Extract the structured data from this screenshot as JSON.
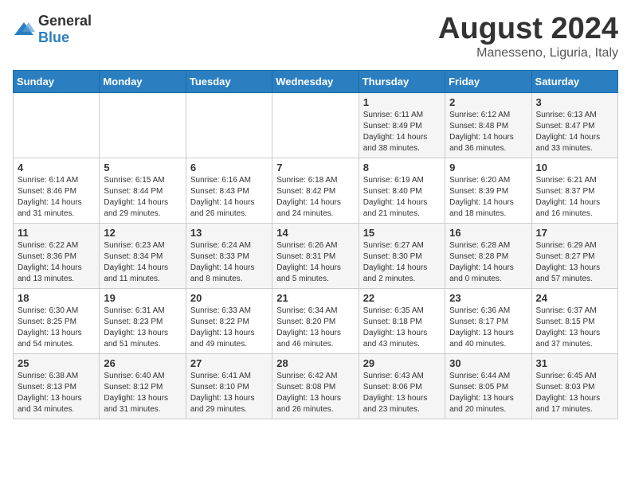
{
  "logo": {
    "text_general": "General",
    "text_blue": "Blue"
  },
  "title": "August 2024",
  "location": "Manesseno, Liguria, Italy",
  "days_of_week": [
    "Sunday",
    "Monday",
    "Tuesday",
    "Wednesday",
    "Thursday",
    "Friday",
    "Saturday"
  ],
  "weeks": [
    [
      {
        "day": "",
        "info": ""
      },
      {
        "day": "",
        "info": ""
      },
      {
        "day": "",
        "info": ""
      },
      {
        "day": "",
        "info": ""
      },
      {
        "day": "1",
        "info": "Sunrise: 6:11 AM\nSunset: 8:49 PM\nDaylight: 14 hours\nand 38 minutes."
      },
      {
        "day": "2",
        "info": "Sunrise: 6:12 AM\nSunset: 8:48 PM\nDaylight: 14 hours\nand 36 minutes."
      },
      {
        "day": "3",
        "info": "Sunrise: 6:13 AM\nSunset: 8:47 PM\nDaylight: 14 hours\nand 33 minutes."
      }
    ],
    [
      {
        "day": "4",
        "info": "Sunrise: 6:14 AM\nSunset: 8:46 PM\nDaylight: 14 hours\nand 31 minutes."
      },
      {
        "day": "5",
        "info": "Sunrise: 6:15 AM\nSunset: 8:44 PM\nDaylight: 14 hours\nand 29 minutes."
      },
      {
        "day": "6",
        "info": "Sunrise: 6:16 AM\nSunset: 8:43 PM\nDaylight: 14 hours\nand 26 minutes."
      },
      {
        "day": "7",
        "info": "Sunrise: 6:18 AM\nSunset: 8:42 PM\nDaylight: 14 hours\nand 24 minutes."
      },
      {
        "day": "8",
        "info": "Sunrise: 6:19 AM\nSunset: 8:40 PM\nDaylight: 14 hours\nand 21 minutes."
      },
      {
        "day": "9",
        "info": "Sunrise: 6:20 AM\nSunset: 8:39 PM\nDaylight: 14 hours\nand 18 minutes."
      },
      {
        "day": "10",
        "info": "Sunrise: 6:21 AM\nSunset: 8:37 PM\nDaylight: 14 hours\nand 16 minutes."
      }
    ],
    [
      {
        "day": "11",
        "info": "Sunrise: 6:22 AM\nSunset: 8:36 PM\nDaylight: 14 hours\nand 13 minutes."
      },
      {
        "day": "12",
        "info": "Sunrise: 6:23 AM\nSunset: 8:34 PM\nDaylight: 14 hours\nand 11 minutes."
      },
      {
        "day": "13",
        "info": "Sunrise: 6:24 AM\nSunset: 8:33 PM\nDaylight: 14 hours\nand 8 minutes."
      },
      {
        "day": "14",
        "info": "Sunrise: 6:26 AM\nSunset: 8:31 PM\nDaylight: 14 hours\nand 5 minutes."
      },
      {
        "day": "15",
        "info": "Sunrise: 6:27 AM\nSunset: 8:30 PM\nDaylight: 14 hours\nand 2 minutes."
      },
      {
        "day": "16",
        "info": "Sunrise: 6:28 AM\nSunset: 8:28 PM\nDaylight: 14 hours\nand 0 minutes."
      },
      {
        "day": "17",
        "info": "Sunrise: 6:29 AM\nSunset: 8:27 PM\nDaylight: 13 hours\nand 57 minutes."
      }
    ],
    [
      {
        "day": "18",
        "info": "Sunrise: 6:30 AM\nSunset: 8:25 PM\nDaylight: 13 hours\nand 54 minutes."
      },
      {
        "day": "19",
        "info": "Sunrise: 6:31 AM\nSunset: 8:23 PM\nDaylight: 13 hours\nand 51 minutes."
      },
      {
        "day": "20",
        "info": "Sunrise: 6:33 AM\nSunset: 8:22 PM\nDaylight: 13 hours\nand 49 minutes."
      },
      {
        "day": "21",
        "info": "Sunrise: 6:34 AM\nSunset: 8:20 PM\nDaylight: 13 hours\nand 46 minutes."
      },
      {
        "day": "22",
        "info": "Sunrise: 6:35 AM\nSunset: 8:18 PM\nDaylight: 13 hours\nand 43 minutes."
      },
      {
        "day": "23",
        "info": "Sunrise: 6:36 AM\nSunset: 8:17 PM\nDaylight: 13 hours\nand 40 minutes."
      },
      {
        "day": "24",
        "info": "Sunrise: 6:37 AM\nSunset: 8:15 PM\nDaylight: 13 hours\nand 37 minutes."
      }
    ],
    [
      {
        "day": "25",
        "info": "Sunrise: 6:38 AM\nSunset: 8:13 PM\nDaylight: 13 hours\nand 34 minutes."
      },
      {
        "day": "26",
        "info": "Sunrise: 6:40 AM\nSunset: 8:12 PM\nDaylight: 13 hours\nand 31 minutes."
      },
      {
        "day": "27",
        "info": "Sunrise: 6:41 AM\nSunset: 8:10 PM\nDaylight: 13 hours\nand 29 minutes."
      },
      {
        "day": "28",
        "info": "Sunrise: 6:42 AM\nSunset: 8:08 PM\nDaylight: 13 hours\nand 26 minutes."
      },
      {
        "day": "29",
        "info": "Sunrise: 6:43 AM\nSunset: 8:06 PM\nDaylight: 13 hours\nand 23 minutes."
      },
      {
        "day": "30",
        "info": "Sunrise: 6:44 AM\nSunset: 8:05 PM\nDaylight: 13 hours\nand 20 minutes."
      },
      {
        "day": "31",
        "info": "Sunrise: 6:45 AM\nSunset: 8:03 PM\nDaylight: 13 hours\nand 17 minutes."
      }
    ]
  ]
}
